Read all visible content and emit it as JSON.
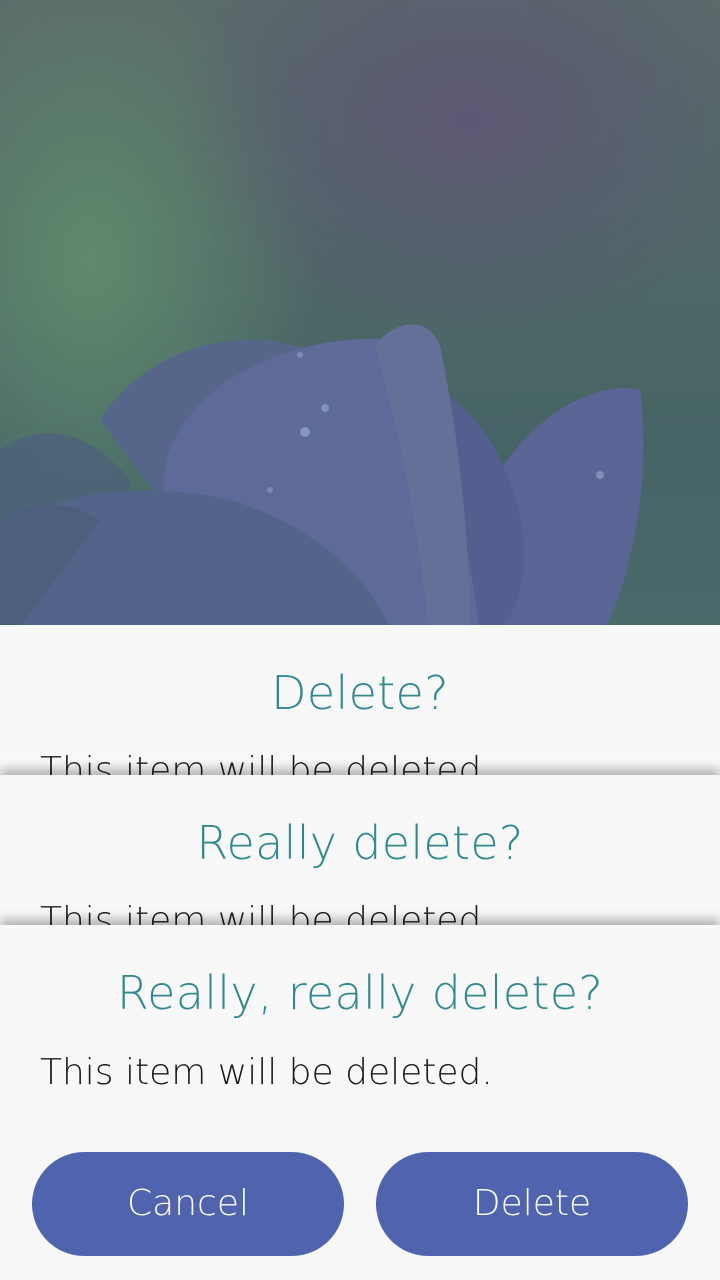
{
  "dialogs": [
    {
      "title": "Delete?",
      "message": "This item will be deleted."
    },
    {
      "title": "Really delete?",
      "message": "This item will be deleted."
    },
    {
      "title": "Really, really delete?",
      "message": "This item will be deleted."
    }
  ],
  "buttons": {
    "cancel_label": "Cancel",
    "delete_label": "Delete"
  },
  "colors": {
    "title": "#2f8a8f",
    "button": "#4f63ae",
    "dialog_bg": "#f8f8f8"
  }
}
